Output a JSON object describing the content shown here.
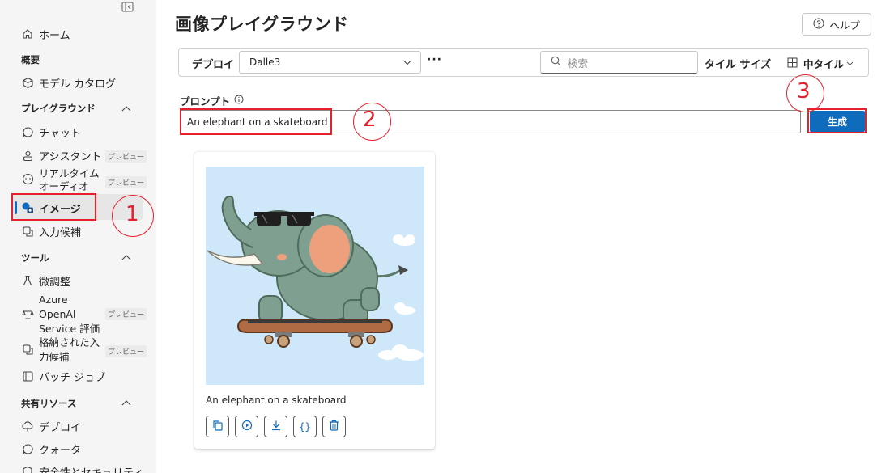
{
  "sidebar": {
    "home": "ホーム",
    "section_overview": "概要",
    "model_catalog": "モデル カタログ",
    "section_playground": "プレイグラウンド",
    "chat": "チャット",
    "assistant": "アシスタント",
    "assistant_badge": "プレビュー",
    "realtime_audio_line1": "リアルタイム",
    "realtime_audio_line2": "オーディオ",
    "realtime_badge": "プレビュー",
    "image": "イメージ",
    "completions": "入力候補",
    "section_tools": "ツール",
    "fine_tuning": "微調整",
    "azure_eval_line1": "Azure",
    "azure_eval_line2": "OpenAI",
    "azure_eval_line3": "Service 評価",
    "azure_eval_badge": "プレビュー",
    "stored_line1": "格納された入",
    "stored_line2": "力候補",
    "stored_badge": "プレビュー",
    "batch_jobs": "バッチ ジョブ",
    "section_shared": "共有リソース",
    "deployments": "デプロイ",
    "quota": "クォータ",
    "safety": "安全性とセキュリティ"
  },
  "annotations": {
    "n1": "1",
    "n2": "2",
    "n3": "3"
  },
  "header": {
    "title": "画像プレイグラウンド",
    "help": "ヘルプ"
  },
  "toolbar": {
    "deploy_label": "デプロイ",
    "deploy_value": "Dalle3",
    "more": "···",
    "search_placeholder": "検索",
    "tile_size_label": "タイル サイズ",
    "tile_size_value": "中タイル"
  },
  "prompt": {
    "label": "プロンプト",
    "value": "An elephant on a skateboard",
    "generate": "生成"
  },
  "result": {
    "caption": "An elephant on a skateboard"
  },
  "colors": {
    "accent": "#0f6cbd",
    "annotation_red": "#e8202b",
    "sidebar_bg": "#f5f5f5"
  }
}
